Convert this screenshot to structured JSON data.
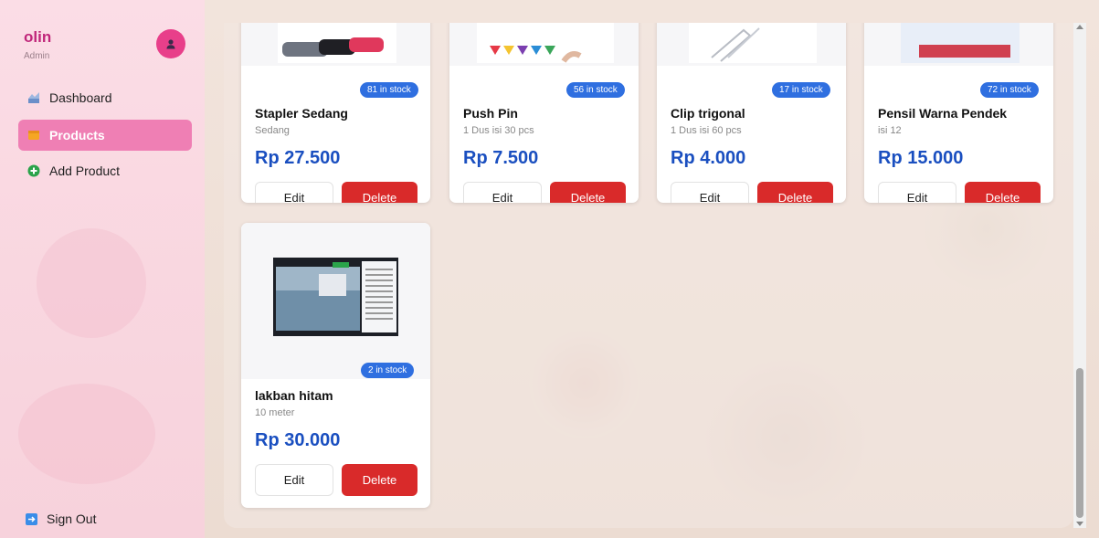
{
  "user": {
    "name": "olin",
    "role": "Admin"
  },
  "nav": [
    {
      "label": "Dashboard",
      "icon": "dashboard-icon"
    },
    {
      "label": "Products",
      "icon": "products-icon",
      "active": true
    },
    {
      "label": "Add Product",
      "icon": "add-circle-icon"
    }
  ],
  "sign_out": "Sign Out",
  "edit_label": "Edit",
  "delete_label": "Delete",
  "products": [
    {
      "name": "Stapler Sedang",
      "desc": "Sedang",
      "price": "Rp 27.500",
      "stock": "81 in stock"
    },
    {
      "name": "Push Pin",
      "desc": "1 Dus isi 30 pcs",
      "price": "Rp 7.500",
      "stock": "56 in stock"
    },
    {
      "name": "Clip trigonal",
      "desc": "1 Dus isi 60 pcs",
      "price": "Rp 4.000",
      "stock": "17 in stock"
    },
    {
      "name": "Pensil Warna Pendek",
      "desc": "isi 12",
      "price": "Rp 15.000",
      "stock": "72 in stock"
    },
    {
      "name": "lakban hitam",
      "desc": "10 meter",
      "price": "Rp 30.000",
      "stock": "2 in stock"
    }
  ],
  "colors": {
    "accent": "#ef7fb4",
    "price": "#1a4fc0",
    "delete": "#d92a2a",
    "badge": "#2f6fe0"
  }
}
